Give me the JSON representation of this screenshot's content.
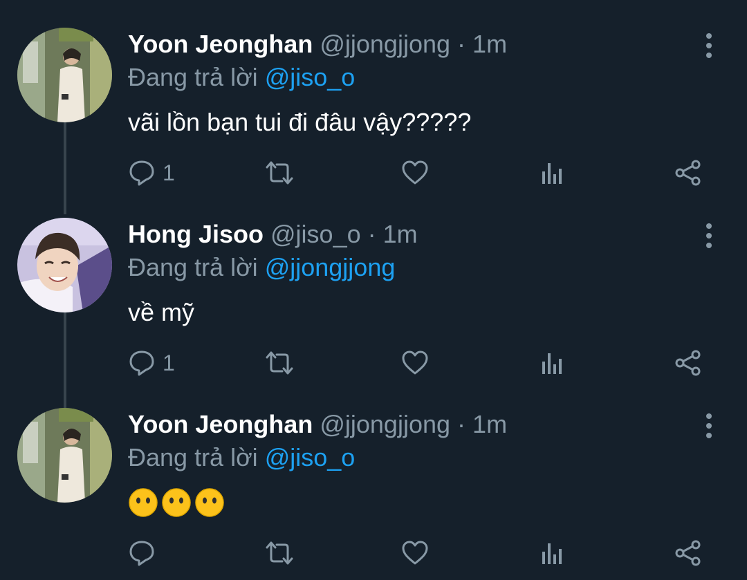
{
  "tweets": [
    {
      "name": "Yoon Jeonghan",
      "handle": "@jjongjjong",
      "separator": "·",
      "time": "1m",
      "replying_prefix": "Đang trả lời",
      "replying_to": "@jiso_o",
      "text": "vãi lồn bạn tui đi đâu vậy?????",
      "reply_count": "1",
      "avatar_icon": "avatar-photo"
    },
    {
      "name": "Hong Jisoo",
      "handle": "@jiso_o",
      "separator": "·",
      "time": "1m",
      "replying_prefix": "Đang trả lời",
      "replying_to": "@jjongjjong",
      "text": "về mỹ",
      "reply_count": "1",
      "avatar_icon": "avatar-photo"
    },
    {
      "name": "Yoon Jeonghan",
      "handle": "@jjongjjong",
      "separator": "·",
      "time": "1m",
      "replying_prefix": "Đang trả lời",
      "replying_to": "@jiso_o",
      "emoji": [
        "🙁",
        "🙁",
        "🙁"
      ],
      "reply_count": "",
      "avatar_icon": "avatar-photo"
    }
  ],
  "icons": {
    "reply": "reply-icon",
    "retweet": "retweet-icon",
    "like": "like-icon",
    "analytics": "analytics-icon",
    "share": "share-icon",
    "more": "more-options-icon"
  },
  "colors": {
    "background": "#15202b",
    "text_primary": "#ffffff",
    "text_secondary": "#8899a6",
    "link": "#1da1f2",
    "thread_line": "#38444d"
  }
}
